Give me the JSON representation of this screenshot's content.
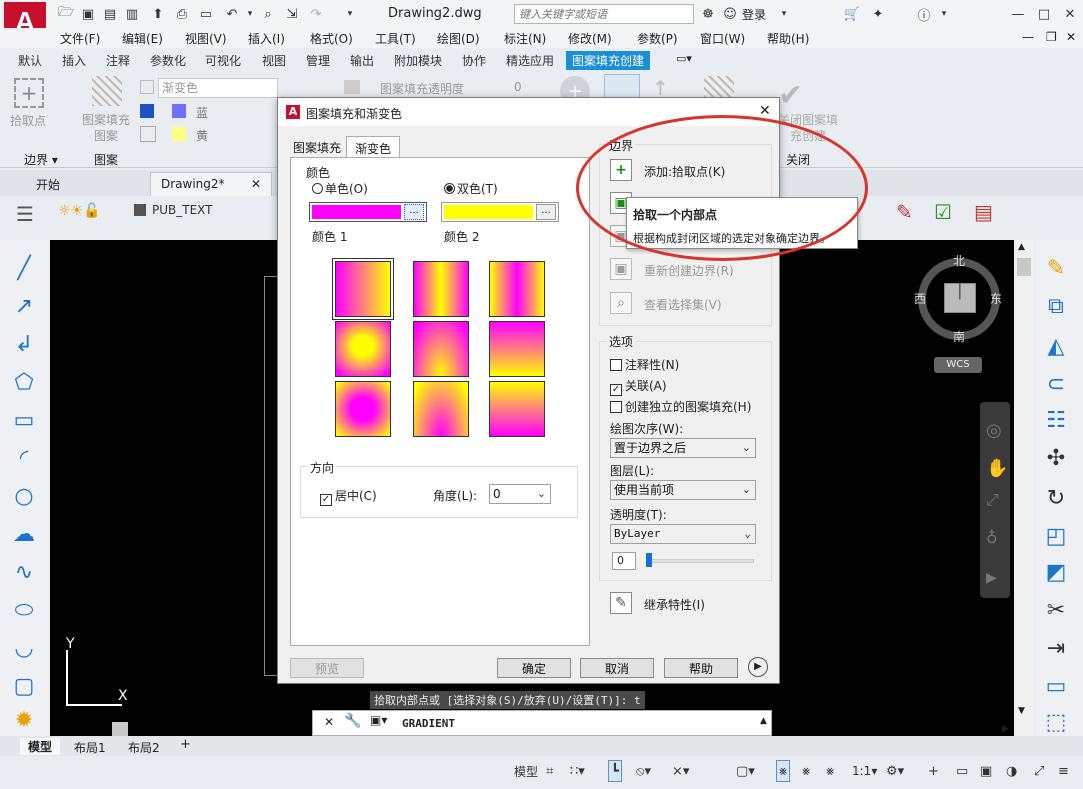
{
  "window": {
    "title": "Drawing2.dwg",
    "search_placeholder": "键入关键字或短语",
    "login": "登录"
  },
  "menu": [
    "文件(F)",
    "编辑(E)",
    "视图(V)",
    "插入(I)",
    "格式(O)",
    "工具(T)",
    "绘图(D)",
    "标注(N)",
    "修改(M)",
    "参数(P)",
    "窗口(W)",
    "帮助(H)"
  ],
  "ribbon_tabs": [
    "默认",
    "插入",
    "注释",
    "参数化",
    "可视化",
    "视图",
    "管理",
    "输出",
    "附加模块",
    "协作",
    "精选应用",
    "图案填充创建"
  ],
  "ribbon": {
    "pick_point": "拾取点",
    "hatch_pattern": "图案填充图案",
    "type": "渐变色",
    "color1": "蓝",
    "color2": "黄",
    "transparency_label": "图案填充透明度",
    "transparency_value": "0",
    "close_label": "关闭图案填充创建",
    "panel_boundary": "边界",
    "panel_pattern": "图案",
    "panel_close": "关闭"
  },
  "doc_tabs": {
    "start": "开始",
    "drawing": "Drawing2*"
  },
  "layer": {
    "name": "PUB_TEXT"
  },
  "viewcube": {
    "north": "北",
    "south": "南",
    "east": "东",
    "west": "西",
    "wcs": "WCS"
  },
  "dialog": {
    "title": "图案填充和渐变色",
    "tab_hatch": "图案填充",
    "tab_gradient": "渐变色",
    "color_section": "颜色",
    "one_color": "单色(O)",
    "two_color": "双色(T)",
    "color1_label": "颜色 1",
    "color2_label": "颜色 2",
    "color1_hex": "#ff00ff",
    "color2_hex": "#ffff00",
    "orientation_section": "方向",
    "centered": "居中(C)",
    "angle_label": "角度(L):",
    "angle_value": "0",
    "boundary_section": "边界",
    "add_pick": "添加:拾取点(K)",
    "recreate_boundary": "重新创建边界(R)",
    "view_selection": "查看选择集(V)",
    "options_section": "选项",
    "annotative": "注释性(N)",
    "associative": "关联(A)",
    "separate": "创建独立的图案填充(H)",
    "draw_order_label": "绘图次序(W):",
    "draw_order_value": "置于边界之后",
    "layer_label": "图层(L):",
    "layer_value": "使用当前项",
    "transparency_label": "透明度(T):",
    "transparency_value": "ByLayer",
    "transparency_num": "0",
    "inherit": "继承特性(I)",
    "preview": "预览",
    "ok": "确定",
    "cancel": "取消",
    "help": "帮助"
  },
  "tooltip": {
    "title": "拾取一个内部点",
    "desc": "根据构成封闭区域的选定对象确定边界。"
  },
  "command": {
    "history": "拾取内部点或 [选择对象(S)/放弃(U)/设置(T)]: t",
    "current": "GRADIENT"
  },
  "layout_tabs": [
    "模型",
    "布局1",
    "布局2"
  ],
  "status": {
    "model": "模型",
    "scale": "1:1"
  },
  "ucs": {
    "x": "X",
    "y": "Y"
  }
}
